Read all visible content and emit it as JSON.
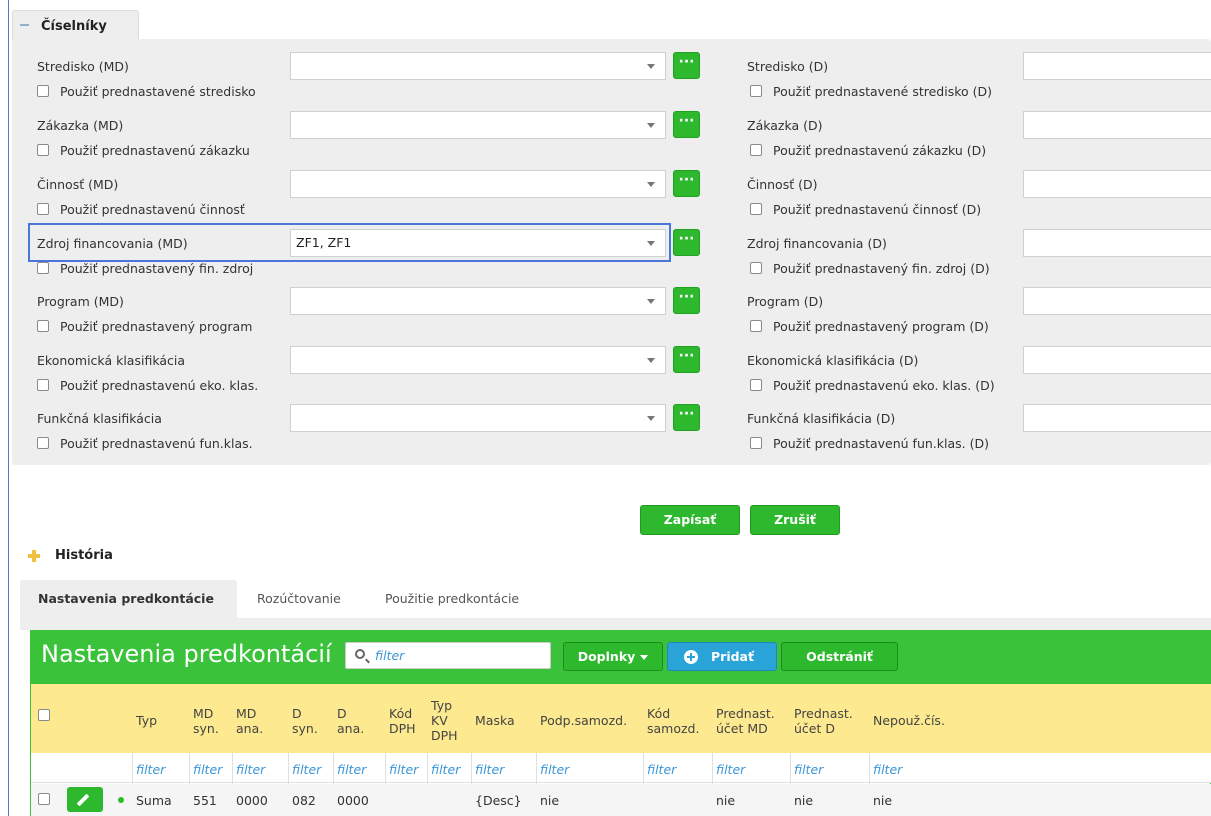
{
  "section": {
    "title": "Číselníky"
  },
  "left_rows": [
    {
      "label": "Stredisko (MD)",
      "value": "",
      "checkbox": "Použiť prednastavené stredisko"
    },
    {
      "label": "Zákazka (MD)",
      "value": "",
      "checkbox": "Použiť prednastavenú zákazku"
    },
    {
      "label": "Činnosť (MD)",
      "value": "",
      "checkbox": "Použiť prednastavenú činnosť"
    },
    {
      "label": "Zdroj financovania (MD)",
      "value": "ZF1, ZF1",
      "checkbox": "Použiť prednastavený fin. zdroj"
    },
    {
      "label": "Program (MD)",
      "value": "",
      "checkbox": "Použiť prednastavený program"
    },
    {
      "label": "Ekonomická klasifikácia",
      "value": "",
      "checkbox": "Použiť prednastavenú eko. klas."
    },
    {
      "label": "Funkčná klasifikácia",
      "value": "",
      "checkbox": "Použiť prednastavenú fun.klas."
    }
  ],
  "right_rows": [
    {
      "label": "Stredisko (D)",
      "checkbox": "Použiť prednastavené stredisko (D)"
    },
    {
      "label": "Zákazka (D)",
      "checkbox": "Použiť prednastavenú zákazku (D)"
    },
    {
      "label": "Činnosť (D)",
      "checkbox": "Použiť prednastavenú činnosť (D)"
    },
    {
      "label": "Zdroj financovania (D)",
      "checkbox": "Použiť prednastavený fin. zdroj (D)"
    },
    {
      "label": "Program (D)",
      "checkbox": "Použiť prednastavený program (D)"
    },
    {
      "label": "Ekonomická klasifikácia (D)",
      "checkbox": "Použiť prednastavenú eko. klas. (D)"
    },
    {
      "label": "Funkčná klasifikácia (D)",
      "checkbox": "Použiť prednastavenú fun.klas. (D)"
    }
  ],
  "lookup_button": "···",
  "actions": {
    "save": "Zapísať",
    "cancel": "Zrušiť"
  },
  "history": {
    "title": "História"
  },
  "tabs": [
    "Nastavenia predkontácie",
    "Rozúčtovanie",
    "Použitie predkontácie"
  ],
  "grid": {
    "title": "Nastavenia predkontácií",
    "filter_placeholder": "filter",
    "dropdown_label": "Doplnky",
    "add_label": "Pridať",
    "remove_label": "Odstrániť",
    "columns": [
      [
        "Typ"
      ],
      [
        "MD",
        "syn."
      ],
      [
        "MD",
        "ana."
      ],
      [
        "D",
        "syn."
      ],
      [
        "D",
        "ana."
      ],
      [
        "Kód",
        "DPH"
      ],
      [
        "Typ",
        "KV",
        "DPH"
      ],
      [
        "Maska"
      ],
      [
        "Podp.samozd."
      ],
      [
        "Kód",
        "samozd."
      ],
      [
        "Prednast.",
        "účet MD"
      ],
      [
        "Prednast.",
        "účet D"
      ],
      [
        "Nepouž.čís."
      ]
    ],
    "filter_text": "filter",
    "rows": [
      [
        "Suma",
        "551",
        "0000",
        "082",
        "0000",
        "",
        "",
        "{Desc}",
        "nie",
        "",
        "nie",
        "nie",
        "nie"
      ]
    ]
  },
  "colors": {
    "green": "#2db82d",
    "blue": "#2aa3d8",
    "header_yellow": "#fde98f",
    "highlight": "#4a76d9"
  }
}
